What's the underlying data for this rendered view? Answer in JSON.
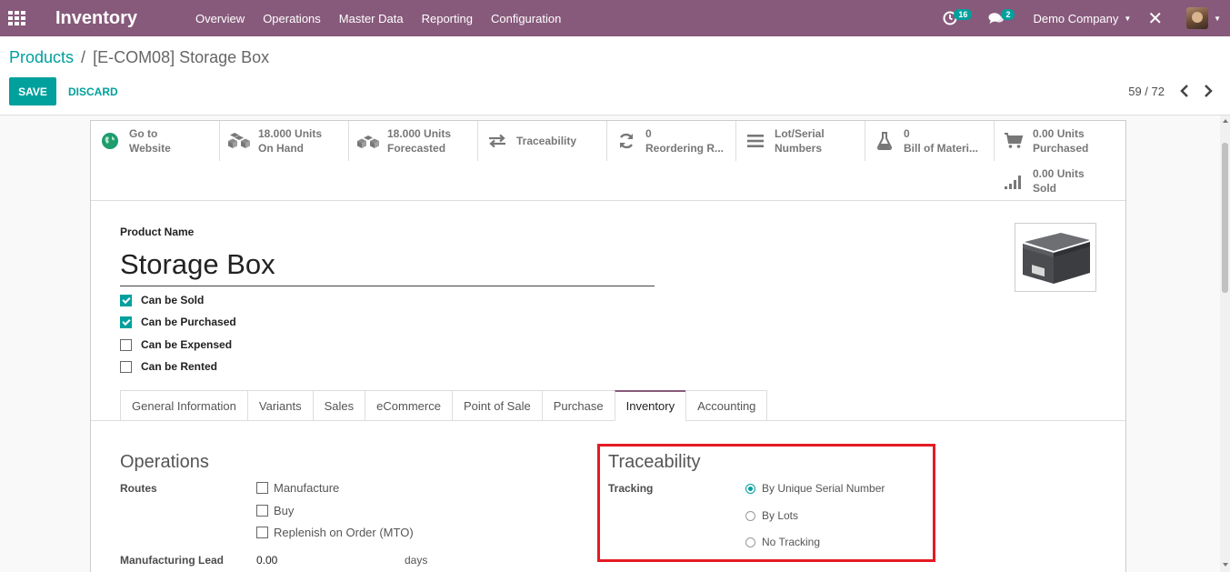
{
  "navbar": {
    "app_name": "Inventory",
    "menu": [
      "Overview",
      "Operations",
      "Master Data",
      "Reporting",
      "Configuration"
    ],
    "activity_count": "16",
    "message_count": "2",
    "company": "Demo Company",
    "bg_color": "#875a7b"
  },
  "breadcrumb": {
    "parent": "Products",
    "separator": "/",
    "current": "[E-COM08] Storage Box"
  },
  "actions": {
    "save": "SAVE",
    "discard": "DISCARD"
  },
  "pager": {
    "value": "59 / 72"
  },
  "smart_buttons": [
    {
      "icon": "globe-icon",
      "line1": "Go to",
      "line2": "Website"
    },
    {
      "icon": "cubes-icon",
      "line1": "18.000 Units",
      "line2": "On Hand"
    },
    {
      "icon": "cubes-icon",
      "line1": "18.000 Units",
      "line2": "Forecasted"
    },
    {
      "icon": "exchange-icon",
      "line1": "Traceability",
      "line2": ""
    },
    {
      "icon": "refresh-icon",
      "line1": "0",
      "line2": "Reordering R..."
    },
    {
      "icon": "list-icon",
      "line1": "Lot/Serial",
      "line2": "Numbers"
    },
    {
      "icon": "flask-icon",
      "line1": "0",
      "line2": "Bill of Materi..."
    },
    {
      "icon": "cart-icon",
      "line1": "0.00 Units",
      "line2": "Purchased"
    },
    {
      "icon": "signal-icon",
      "line1": "0.00 Units",
      "line2": "Sold"
    }
  ],
  "product": {
    "name_label": "Product Name",
    "name": "Storage Box",
    "checks": [
      {
        "label": "Can be Sold",
        "checked": true
      },
      {
        "label": "Can be Purchased",
        "checked": true
      },
      {
        "label": "Can be Expensed",
        "checked": false
      },
      {
        "label": "Can be Rented",
        "checked": false
      }
    ]
  },
  "tabs": [
    "General Information",
    "Variants",
    "Sales",
    "eCommerce",
    "Point of Sale",
    "Purchase",
    "Inventory",
    "Accounting"
  ],
  "active_tab": "Inventory",
  "operations": {
    "title": "Operations",
    "routes_label": "Routes",
    "routes": [
      {
        "label": "Manufacture",
        "checked": false
      },
      {
        "label": "Buy",
        "checked": false
      },
      {
        "label": "Replenish on Order (MTO)",
        "checked": false
      }
    ],
    "lead_label": "Manufacturing Lead",
    "lead_value": "0.00",
    "lead_unit": "days"
  },
  "traceability": {
    "title": "Traceability",
    "tracking_label": "Tracking",
    "options": [
      {
        "label": "By Unique Serial Number",
        "selected": true
      },
      {
        "label": "By Lots",
        "selected": false
      },
      {
        "label": "No Tracking",
        "selected": false
      }
    ],
    "highlight_color": "#e31b23"
  },
  "accent_color": "#00a09d"
}
